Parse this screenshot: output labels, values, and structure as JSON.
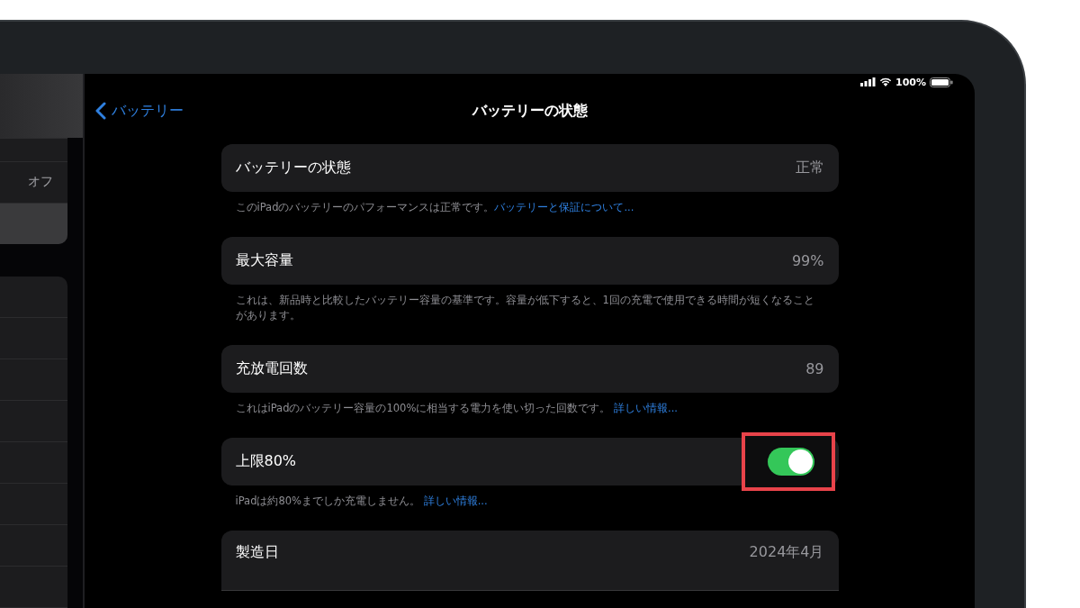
{
  "sidebar": {
    "items": [
      {
        "value": "オフ",
        "selected": false
      },
      {
        "selected": true
      }
    ]
  },
  "status_bar": {
    "battery": "100%"
  },
  "nav": {
    "back": "バッテリー",
    "title": "バッテリーの状態"
  },
  "sections": [
    {
      "kind": "value",
      "label": "バッテリーの状態",
      "value": "正常",
      "footer": {
        "text": "このiPadのバッテリーのパフォーマンスは正常です。",
        "link": "バッテリーと保証について..."
      }
    },
    {
      "kind": "value",
      "label": "最大容量",
      "value": "99%",
      "footer": {
        "text": "これは、新品時と比較したバッテリー容量の基準です。容量が低下すると、1回の充電で使用できる時間が短くなることがあります。"
      }
    },
    {
      "kind": "value",
      "label": "充放電回数",
      "value": "89",
      "footer": {
        "text": "これはiPadのバッテリー容量の100%に相当する電力を使い切った回数です。 ",
        "link": "詳しい情報..."
      }
    },
    {
      "kind": "toggle",
      "label": "上限80%",
      "on": true,
      "highlighted": true,
      "footer": {
        "text": "iPadは約80%までしか充電しません。 ",
        "link": "詳しい情報..."
      }
    },
    {
      "kind": "value",
      "label": "製造日",
      "value": "2024年4月"
    }
  ]
}
